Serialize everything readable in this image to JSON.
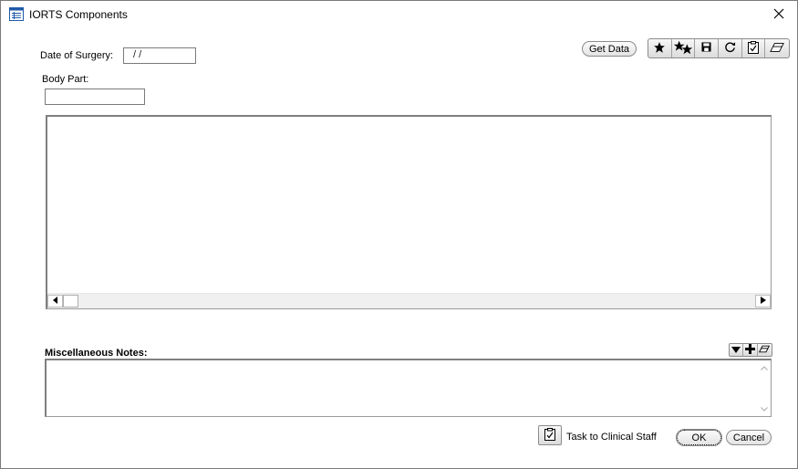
{
  "window": {
    "title": "IORTS Components",
    "close_glyph": "✕"
  },
  "form": {
    "date_label": "Date of Surgery:",
    "date_value": " /  /",
    "body_part_label": "Body Part:",
    "body_part_value": "",
    "get_data_label": "Get Data"
  },
  "toolbar": {
    "icons": [
      "star-icon",
      "stars-icon",
      "save-icon",
      "refresh-icon",
      "clipboard-icon",
      "eraser-icon"
    ]
  },
  "notes": {
    "label": "Miscellaneous Notes:",
    "value": "",
    "toolbar_icons": [
      "dropdown-icon",
      "add-icon",
      "eraser-icon"
    ]
  },
  "footer": {
    "task_label": "Task to Clinical Staff",
    "ok_label": "OK",
    "cancel_label": "Cancel"
  }
}
